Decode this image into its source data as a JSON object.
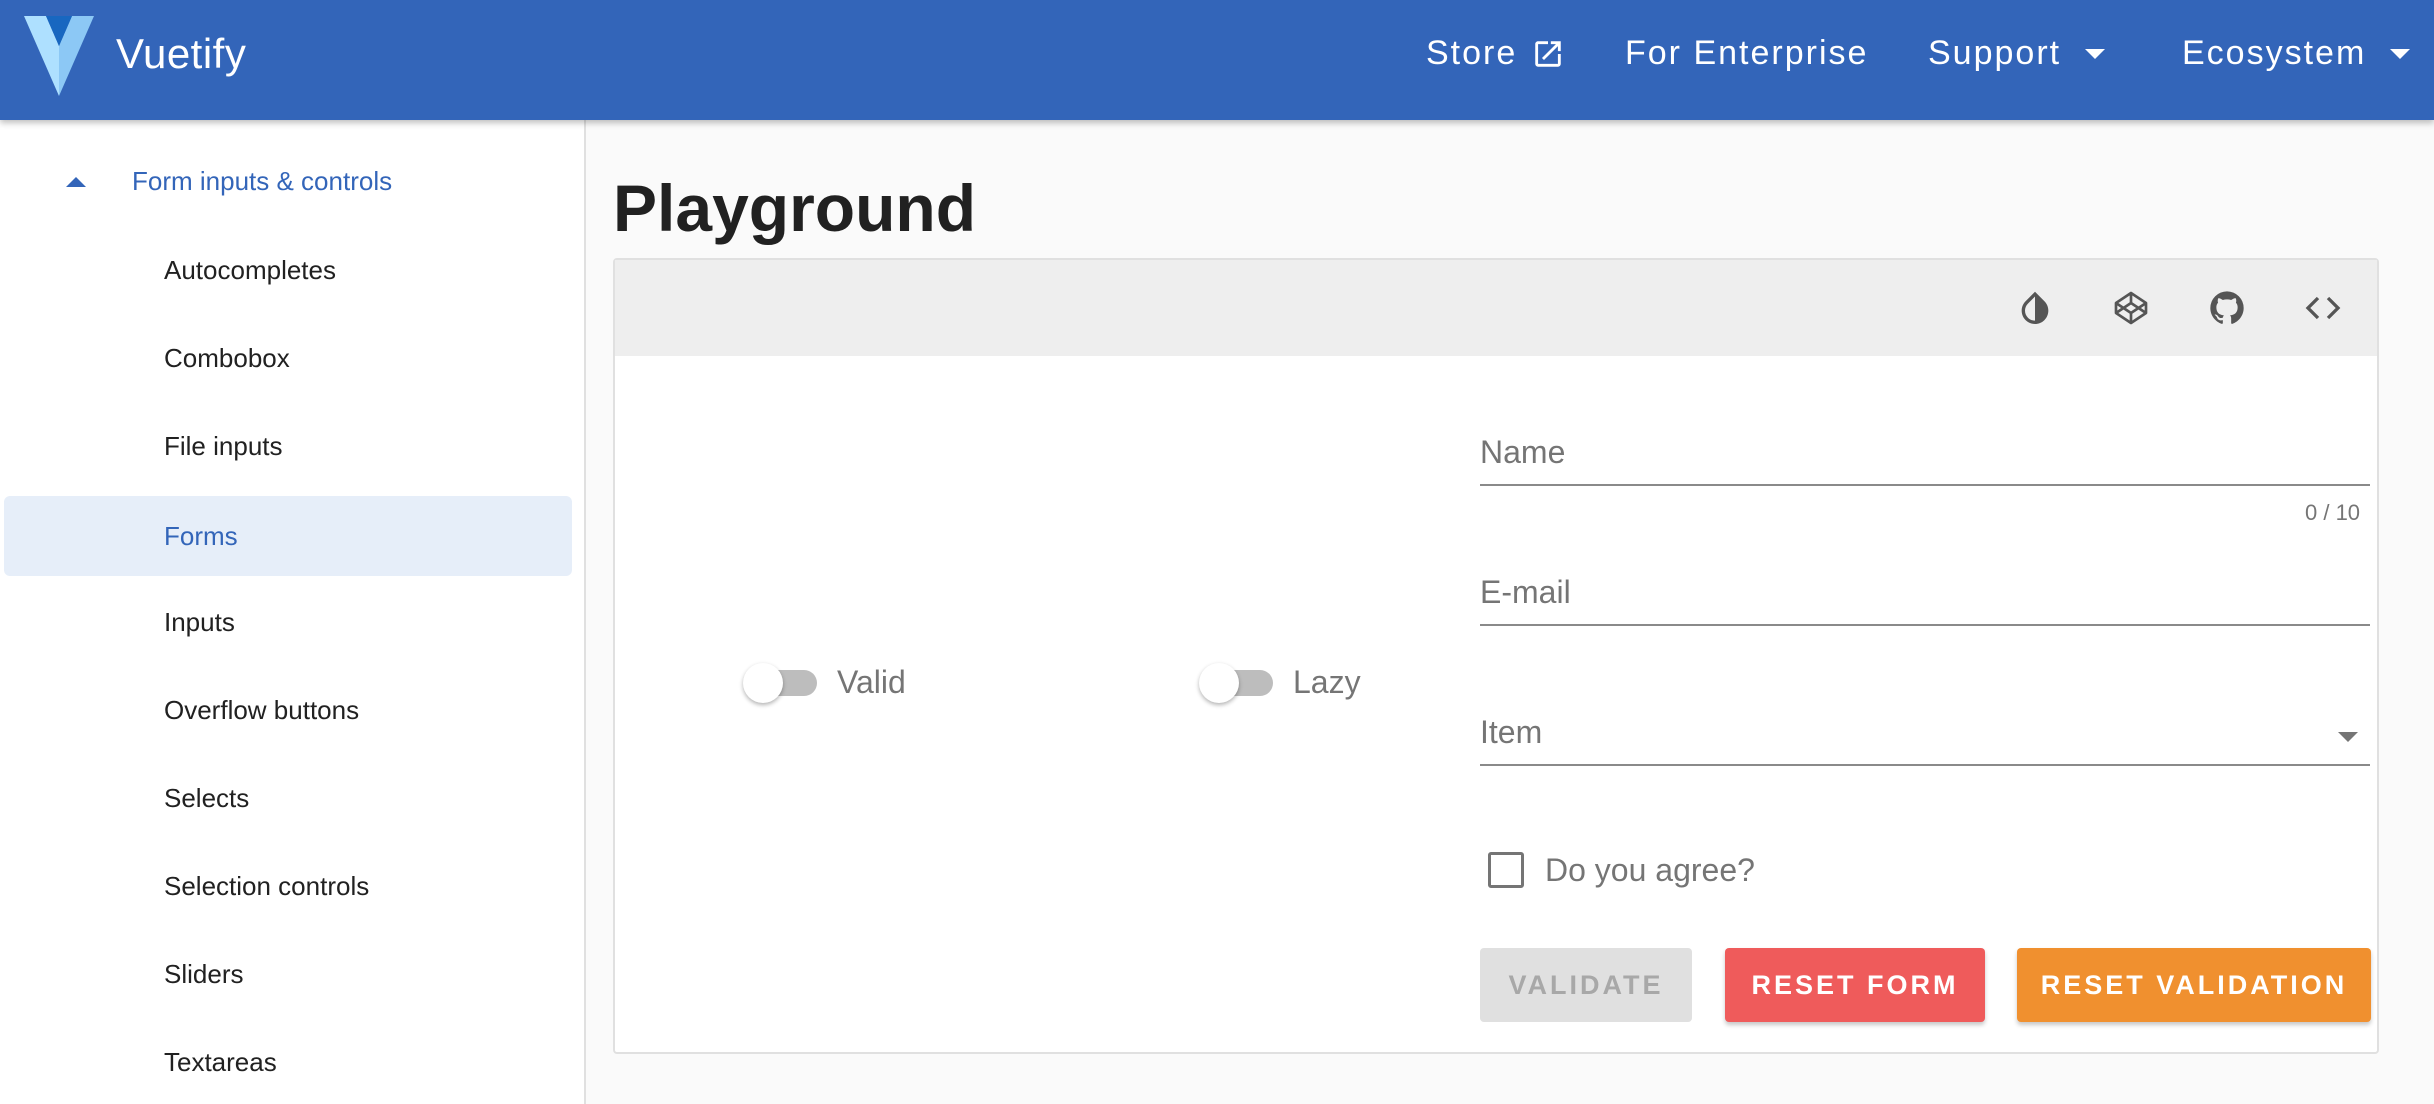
{
  "appbar": {
    "brand": "Vuetify",
    "nav": {
      "store": "Store",
      "enterprise": "For Enterprise",
      "support": "Support",
      "ecosystem": "Ecosystem"
    }
  },
  "sidebar": {
    "group_label": "Form inputs & controls",
    "items": [
      {
        "label": "Autocompletes"
      },
      {
        "label": "Combobox"
      },
      {
        "label": "File inputs"
      },
      {
        "label": "Forms",
        "active": true
      },
      {
        "label": "Inputs"
      },
      {
        "label": "Overflow buttons"
      },
      {
        "label": "Selects"
      },
      {
        "label": "Selection controls"
      },
      {
        "label": "Sliders"
      },
      {
        "label": "Textareas"
      }
    ]
  },
  "main": {
    "title": "Playground",
    "toolbar_icons": [
      "invert-colors-icon",
      "codepen-icon",
      "github-icon",
      "code-icon"
    ],
    "switches": {
      "valid": {
        "label": "Valid",
        "on": false
      },
      "lazy": {
        "label": "Lazy",
        "on": false
      }
    },
    "form": {
      "name_label": "Name",
      "name_counter": "0 / 10",
      "email_label": "E-mail",
      "item_label": "Item",
      "agree_label": "Do you agree?",
      "buttons": {
        "validate": "VALIDATE",
        "reset": "RESET FORM",
        "reset_validation": "RESET VALIDATION"
      }
    }
  },
  "colors": {
    "primary": "#3365b9",
    "error": "#ef5b5b",
    "warning": "#f0902f"
  }
}
